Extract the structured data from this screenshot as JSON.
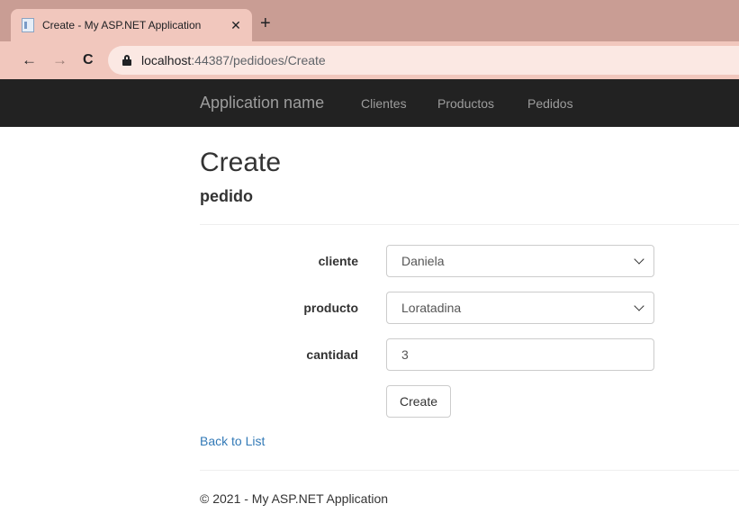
{
  "browser": {
    "tab_title": "Create - My ASP.NET Application",
    "tab_close": "✕",
    "new_tab": "+",
    "nav": {
      "back": "←",
      "forward": "→",
      "reload": "C"
    },
    "url_host": "localhost",
    "url_path": ":44387/pedidoes/Create"
  },
  "navbar": {
    "brand": "Application name",
    "links": [
      "Clientes",
      "Productos",
      "Pedidos"
    ]
  },
  "page": {
    "title": "Create",
    "subtitle": "pedido"
  },
  "form": {
    "fields": [
      {
        "label": "cliente",
        "value": "Daniela",
        "type": "select"
      },
      {
        "label": "producto",
        "value": "Loratadina",
        "type": "select"
      },
      {
        "label": "cantidad",
        "value": "3",
        "type": "text"
      }
    ],
    "submit_label": "Create"
  },
  "back_link": "Back to List",
  "footer": "© 2021 - My ASP.NET Application",
  "colors": {
    "tabstrip": "#c99d94",
    "toolbar": "#f1c7bd",
    "navbar": "#222222",
    "link": "#337ab7"
  }
}
